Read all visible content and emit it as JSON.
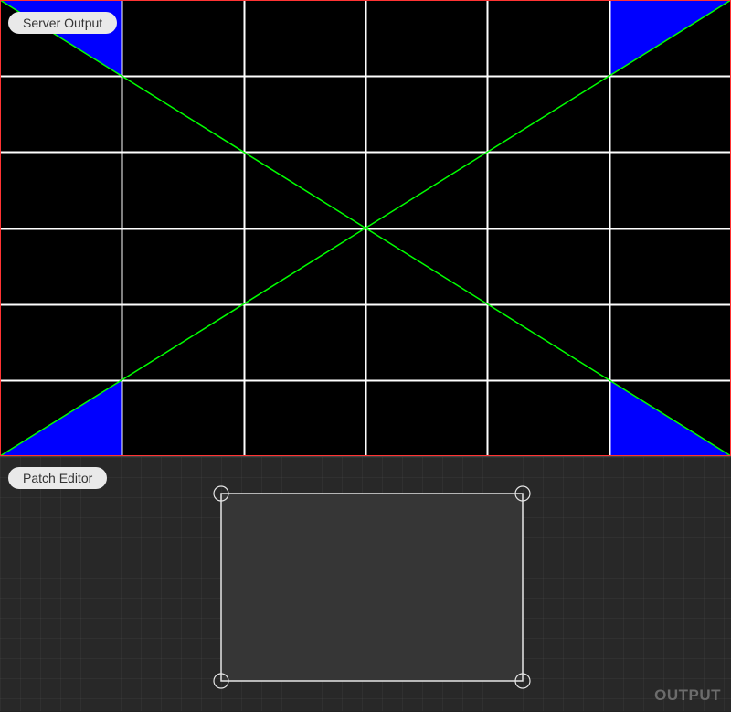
{
  "server_output": {
    "label": "Server Output",
    "grid": {
      "columns": 6,
      "rows": 6
    },
    "colors": {
      "background": "#000000",
      "grid_line": "#ffffff",
      "corner_fill": "#0000ff",
      "diagonal": "#00ff00",
      "border": "#ff3333"
    }
  },
  "patch_editor": {
    "label": "Patch Editor",
    "output_tag": "OUTPUT",
    "colors": {
      "background": "#282828",
      "patch_fill": "#363636",
      "patch_stroke": "#e6e6e6"
    }
  }
}
